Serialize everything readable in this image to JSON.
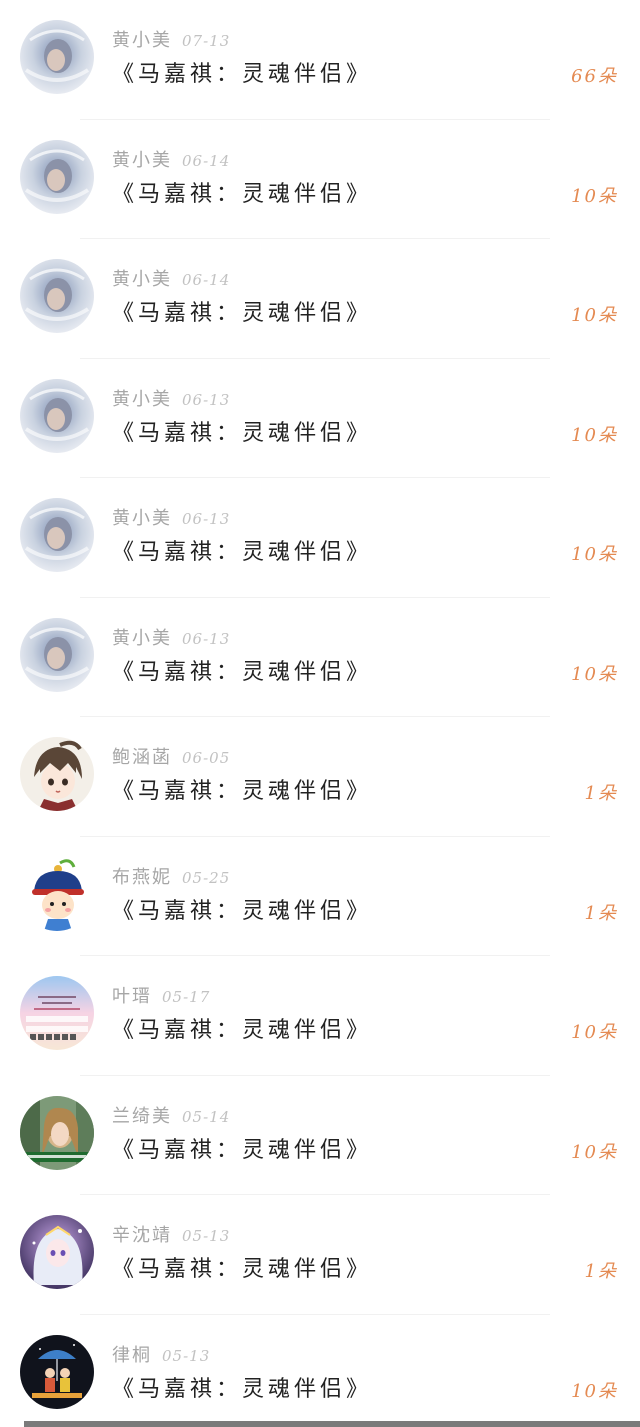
{
  "rows": [
    {
      "name": "黄小美",
      "date": "07-13",
      "title": "《马嘉祺：灵魂伴侣》",
      "count": "66朵",
      "avatar": "lace-portrait-icon"
    },
    {
      "name": "黄小美",
      "date": "06-14",
      "title": "《马嘉祺：灵魂伴侣》",
      "count": "10朵",
      "avatar": "lace-portrait-icon"
    },
    {
      "name": "黄小美",
      "date": "06-14",
      "title": "《马嘉祺：灵魂伴侣》",
      "count": "10朵",
      "avatar": "lace-portrait-icon"
    },
    {
      "name": "黄小美",
      "date": "06-13",
      "title": "《马嘉祺：灵魂伴侣》",
      "count": "10朵",
      "avatar": "lace-portrait-icon"
    },
    {
      "name": "黄小美",
      "date": "06-13",
      "title": "《马嘉祺：灵魂伴侣》",
      "count": "10朵",
      "avatar": "lace-portrait-icon"
    },
    {
      "name": "黄小美",
      "date": "06-13",
      "title": "《马嘉祺：灵魂伴侣》",
      "count": "10朵",
      "avatar": "lace-portrait-icon"
    },
    {
      "name": "鲍涵菡",
      "date": "06-05",
      "title": "《马嘉祺：灵魂伴侣》",
      "count": "1朵",
      "avatar": "anime-boy-icon"
    },
    {
      "name": "布燕妮",
      "date": "05-25",
      "title": "《马嘉祺：灵魂伴侣》",
      "count": "1朵",
      "avatar": "cartoon-qing-official-icon"
    },
    {
      "name": "叶瑨",
      "date": "05-17",
      "title": "《马嘉祺：灵魂伴侣》",
      "count": "10朵",
      "avatar": "keyboard-pastel-icon"
    },
    {
      "name": "兰绮美",
      "date": "05-14",
      "title": "《马嘉祺：灵魂伴侣》",
      "count": "10朵",
      "avatar": "photo-girl-forest-icon"
    },
    {
      "name": "辛沈靖",
      "date": "05-13",
      "title": "《马嘉祺：灵魂伴侣》",
      "count": "1朵",
      "avatar": "anime-girl-white-hair-icon"
    },
    {
      "name": "律桐",
      "date": "05-13",
      "title": "《马嘉祺：灵魂伴侣》",
      "count": "10朵",
      "avatar": "umbrella-couple-icon"
    }
  ],
  "colors": {
    "count": "#e48a52",
    "name": "#a6a6a6",
    "title": "#222222"
  }
}
